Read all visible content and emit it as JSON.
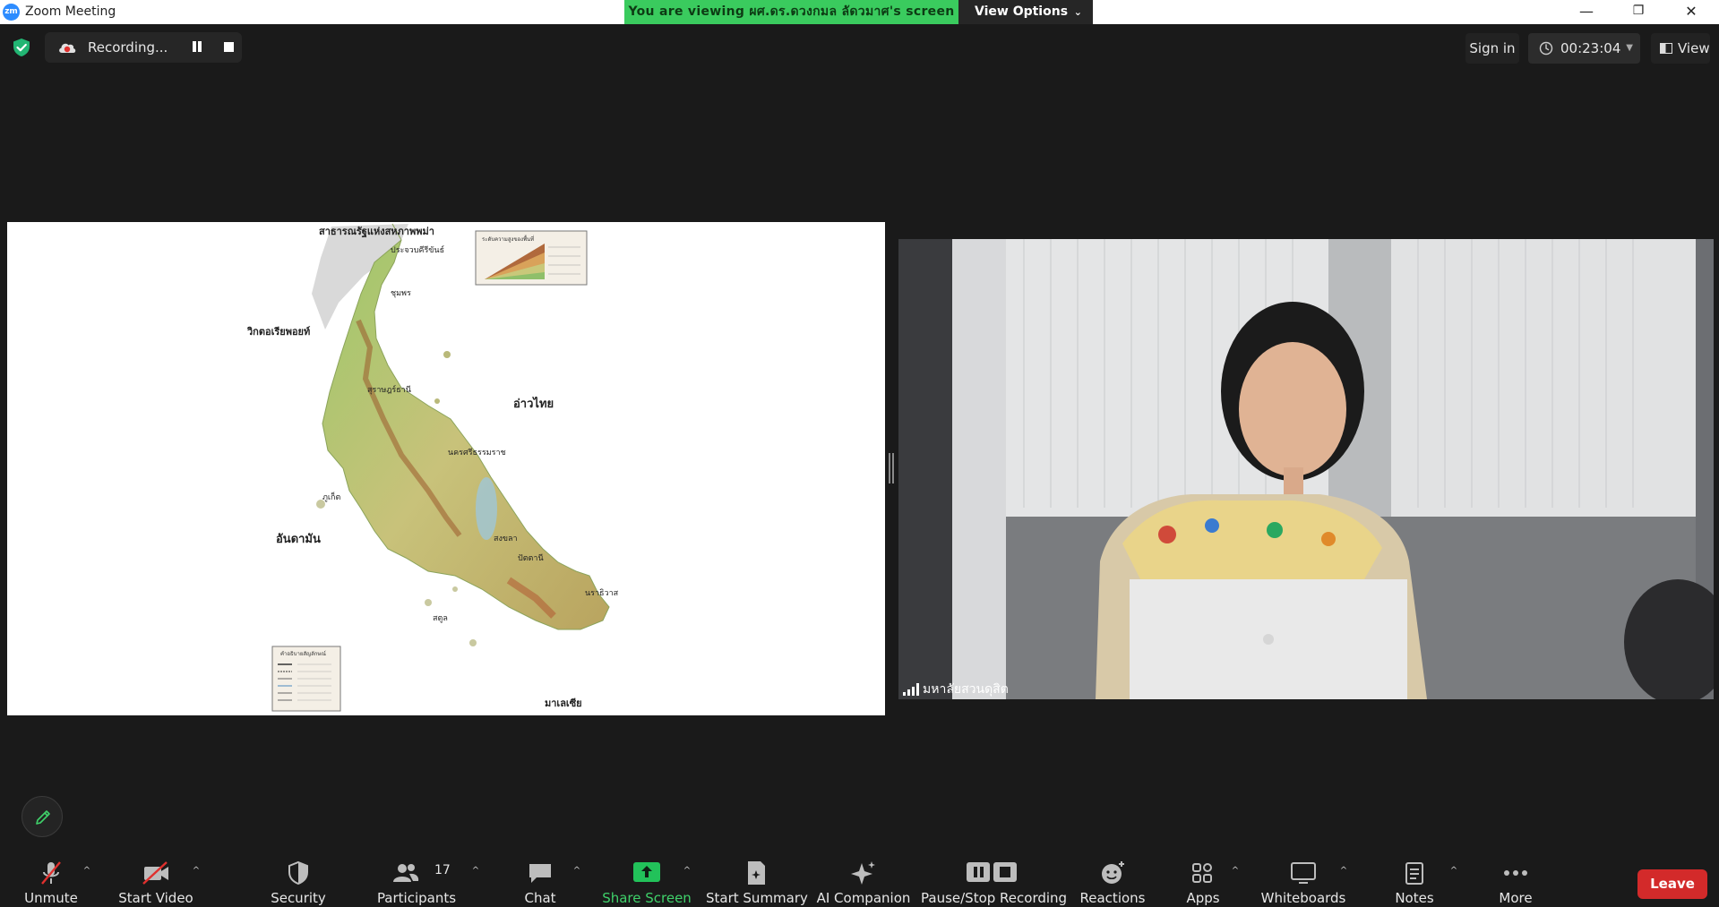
{
  "window": {
    "title": "Zoom Meeting",
    "app_icon_text": "zm",
    "minimize": "—",
    "restore": "❐",
    "close": "✕"
  },
  "banner": {
    "viewing_text": "You are viewing ผศ.ดร.ดวงกมล ลัดวมาศ's screen",
    "view_options_label": "View Options"
  },
  "topbar": {
    "recording_label": "Recording...",
    "sign_in_label": "Sign in",
    "timer": "00:23:04",
    "view_label": "View"
  },
  "shared_screen": {
    "labels": {
      "myanmar": "สาธารณรัฐแห่งสหภาพพม่า",
      "prachuap": "ประจวบคีรีขันธ์",
      "chumphon": "ชุมพร",
      "victoria_point": "วิกตอเรียพอยท์",
      "gulf_of_thailand": "อ่าวไทย",
      "surat_thani": "สุราษฎร์ธานี",
      "nakhon_si_thammarat": "นครศรีธรรมราช",
      "phuket": "ภูเก็ต",
      "andaman": "อันดามัน",
      "songkhla": "สงขลา",
      "pattani": "ปัตตานี",
      "narathiwat": "นราธิวาส",
      "satun": "สตูล",
      "malaysia": "มาเลเซีย",
      "legend_title": "คำอธิบายสัญลักษณ์",
      "relief_title": "ระดับความสูงของพื้นที่"
    }
  },
  "video": {
    "participant_name": "มหาลัยสวนดุสิต"
  },
  "toolbar": {
    "unmute": "Unmute",
    "start_video": "Start Video",
    "security": "Security",
    "participants": "Participants",
    "participants_count": "17",
    "chat": "Chat",
    "share_screen": "Share Screen",
    "start_summary": "Start Summary",
    "ai_companion": "AI Companion",
    "pause_stop_recording": "Pause/Stop Recording",
    "reactions": "Reactions",
    "apps": "Apps",
    "whiteboards": "Whiteboards",
    "notes": "Notes",
    "more": "More",
    "leave": "Leave"
  },
  "colors": {
    "banner_green": "#3acb5e",
    "leave_red": "#d32a2a",
    "share_green": "#22c25a",
    "toolbar_bg": "#1a1a1a"
  }
}
